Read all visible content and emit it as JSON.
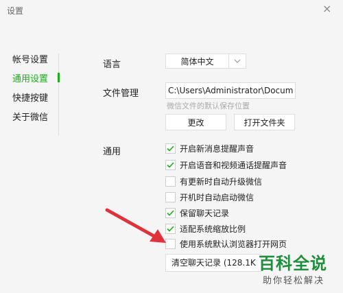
{
  "window": {
    "title": "设置",
    "close_glyph": "×"
  },
  "sidebar": {
    "items": [
      {
        "label": "帐号设置",
        "active": false
      },
      {
        "label": "通用设置",
        "active": true
      },
      {
        "label": "快捷按键",
        "active": false
      },
      {
        "label": "关于微信",
        "active": false
      }
    ]
  },
  "language": {
    "label": "语言",
    "selected": "简体中文"
  },
  "file_management": {
    "label": "文件管理",
    "path": "C:\\Users\\Administrator\\Docum",
    "hint": "微信文件的默认保存位置",
    "change_label": "更改",
    "open_folder_label": "打开文件夹"
  },
  "general": {
    "label": "通用",
    "options": [
      {
        "label": "开启新消息提醒声音",
        "checked": true
      },
      {
        "label": "开启语音和视频通话提醒声音",
        "checked": true
      },
      {
        "label": "有更新时自动升级微信",
        "checked": false
      },
      {
        "label": "开机时自动启动微信",
        "checked": false
      },
      {
        "label": "保留聊天记录",
        "checked": true
      },
      {
        "label": "适配系统缩放比例",
        "checked": true
      },
      {
        "label": "使用系统默认浏览器打开网页",
        "checked": false
      }
    ],
    "clear_history_label": "清空聊天记录 (128.1K"
  },
  "watermark": {
    "main": "百科全说",
    "sub": "助你轻松解决"
  },
  "colors": {
    "accent": "#1aad19",
    "arrow": "#e0323a",
    "watermark": "#1d8e3a"
  }
}
